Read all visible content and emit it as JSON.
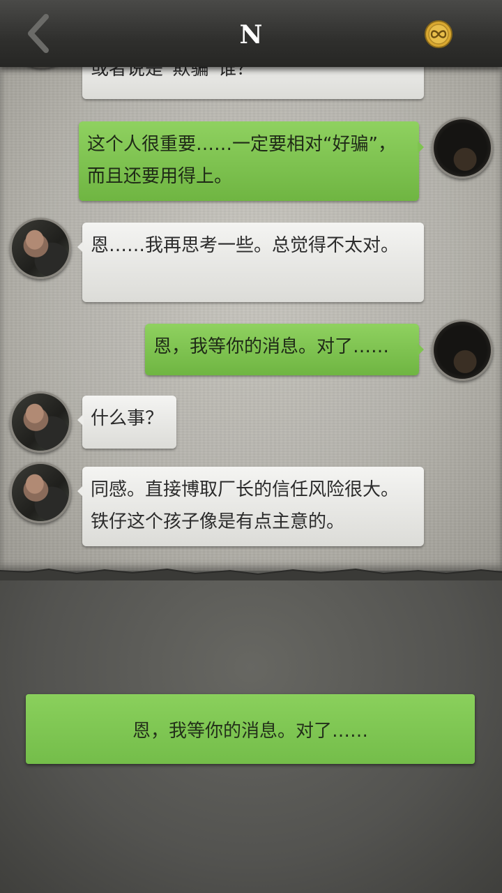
{
  "header": {
    "title": "N",
    "back_icon": "chevron-left-icon",
    "coin_icon": "infinity-coin-icon"
  },
  "messages": [
    {
      "side": "in",
      "text": "或者说是“欺骗”谁？"
    },
    {
      "side": "out",
      "text": "这个人很重要……一定要相对“好骗”，而且还要用得上。"
    },
    {
      "side": "in",
      "text": "恩……我再思考一些。总觉得不太对。"
    },
    {
      "side": "out",
      "text": "恩，我等你的消息。对了……"
    },
    {
      "side": "in",
      "text": "什么事？"
    },
    {
      "side": "in",
      "text": "同感。直接博取厂长的信任风险很大。铁仔这个孩子像是有点主意的。"
    }
  ],
  "reply": {
    "option_label": "恩，我等你的消息。对了……"
  },
  "colors": {
    "bubble_out": "#7fc350",
    "bubble_in": "#ecece9",
    "header": "#2f2f2d",
    "coin": "#d9a830"
  }
}
